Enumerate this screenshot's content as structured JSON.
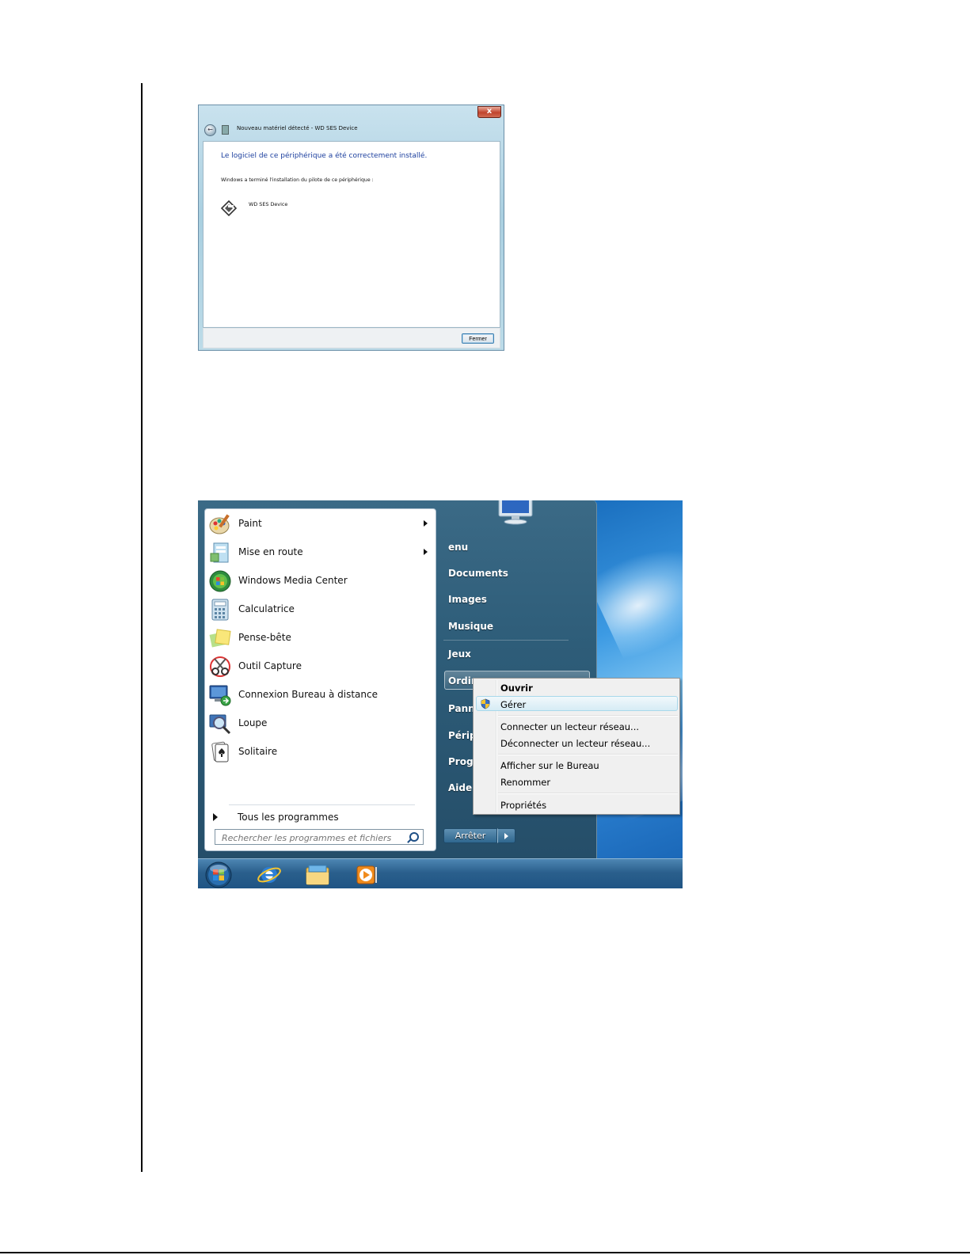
{
  "dialog": {
    "close_glyph": "x",
    "title": "Nouveau matériel détecté - WD SES Device",
    "heading": "Le logiciel de ce périphérique a été correctement installé.",
    "subtext": "Windows a terminé l'installation du pilote de ce périphérique :",
    "device_name": "WD SES Device",
    "close_button": "Fermer"
  },
  "start_menu": {
    "programs": [
      {
        "label": "Paint",
        "icon": "paint-icon",
        "has_submenu": true
      },
      {
        "label": "Mise en route",
        "icon": "getting-started-icon",
        "has_submenu": true
      },
      {
        "label": "Windows Media Center",
        "icon": "media-center-icon",
        "has_submenu": false
      },
      {
        "label": "Calculatrice",
        "icon": "calculator-icon",
        "has_submenu": false
      },
      {
        "label": "Pense-bête",
        "icon": "sticky-notes-icon",
        "has_submenu": false
      },
      {
        "label": "Outil Capture",
        "icon": "snipping-tool-icon",
        "has_submenu": false
      },
      {
        "label": "Connexion Bureau à distance",
        "icon": "remote-desktop-icon",
        "has_submenu": false
      },
      {
        "label": "Loupe",
        "icon": "magnifier-icon",
        "has_submenu": false
      },
      {
        "label": "Solitaire",
        "icon": "solitaire-icon",
        "has_submenu": false
      }
    ],
    "all_programs": "Tous les programmes",
    "search_placeholder": "Rechercher les programmes et fichiers",
    "right_items": [
      "enu",
      "Documents",
      "Images",
      "Musique",
      "Jeux",
      "Ordin",
      "Pann",
      "Périp",
      "Progr",
      "Aide e"
    ],
    "shutdown": "Arrêter"
  },
  "context_menu": {
    "items": [
      "Ouvrir",
      "Gérer",
      "Connecter un lecteur réseau...",
      "Déconnecter un lecteur réseau...",
      "Afficher sur le Bureau",
      "Renommer",
      "Propriétés"
    ],
    "default_item": "Ouvrir",
    "highlighted_item": "Gérer"
  },
  "taskbar": {
    "icons": [
      "start-orb-icon",
      "internet-explorer-icon",
      "windows-explorer-icon",
      "media-player-icon"
    ]
  },
  "colors": {
    "dialog_heading": "#1c3f9e",
    "start_menu_bg": "#2e5d79",
    "taskbar": "#2a5f8c"
  }
}
